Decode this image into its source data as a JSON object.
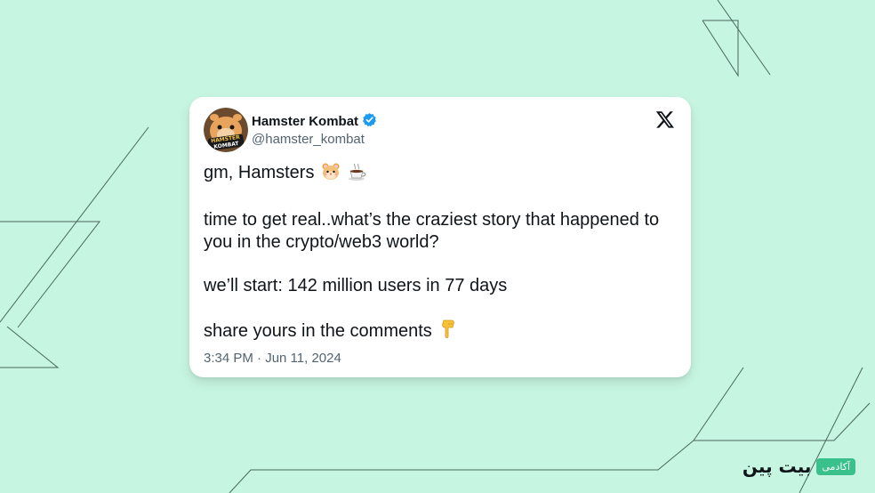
{
  "tweet": {
    "display_name": "Hamster Kombat",
    "handle": "@hamster_kombat",
    "verified": true,
    "avatar_text": [
      "HAMSTER",
      "KOMBAT"
    ],
    "platform_icon": "x-logo-icon",
    "lines": [
      "gm, Hamsters",
      "time to get real..what’s the craziest story that happened to you in the crypto/web3 world?",
      "we’ll start: 142 million users in 77 days",
      "share yours in the comments"
    ],
    "emojis": [
      "hamster-face-icon",
      "hot-beverage-icon",
      "pointing-down-icon"
    ],
    "timestamp": "3:34 PM · Jun 11, 2024"
  },
  "brand": {
    "badge": "آکادمی",
    "name": "بیت پین"
  },
  "colors": {
    "background": "#c6f5e1",
    "card": "#ffffff",
    "verified": "#1d9bf0",
    "text": "#0f1419",
    "muted": "#536471",
    "brand_badge": "#39c08b"
  }
}
